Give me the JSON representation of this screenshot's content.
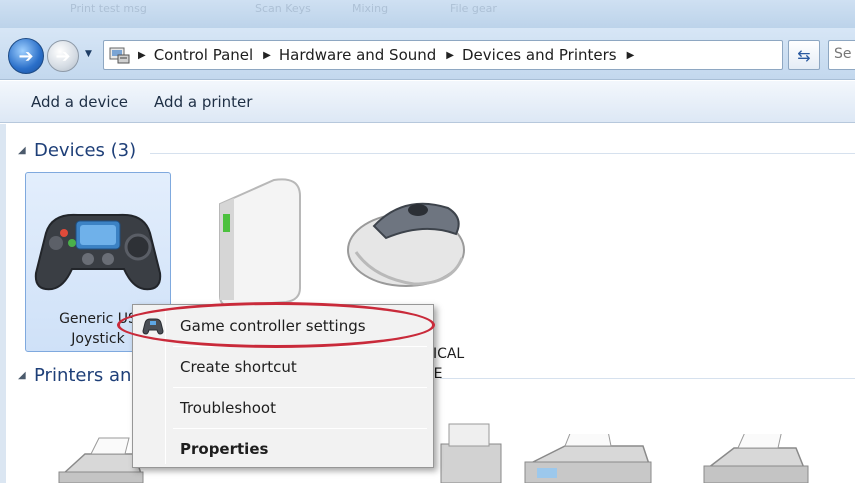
{
  "window": {
    "menu_ghosts": [
      "Print test msg",
      "Scan Keys",
      "Mixing",
      "File gear"
    ]
  },
  "nav": {
    "breadcrumbs": [
      "Control Panel",
      "Hardware and Sound",
      "Devices and Printers"
    ],
    "search_placeholder": "Se"
  },
  "command_bar": {
    "add_device": "Add a device",
    "add_printer": "Add a printer"
  },
  "groups": {
    "devices_title": "Devices (3)",
    "printers_title": "Printers an"
  },
  "devices": [
    {
      "label_line1": "Generic  US",
      "label_line2": "Joystick",
      "icon": "gamepad-icon",
      "selected": true
    },
    {
      "label_line1": "",
      "label_line2": "",
      "icon": "external-drive-icon",
      "selected": false
    },
    {
      "label_line1": "USB OPTICAL",
      "label_line2": "E",
      "icon": "mouse-icon",
      "selected": false
    }
  ],
  "context_menu": {
    "items": [
      {
        "label": "Game controller settings",
        "icon": "gamepad-icon",
        "bold": false
      },
      {
        "label": "Create shortcut",
        "bold": false
      },
      {
        "label": "Troubleshoot",
        "bold": false
      },
      {
        "label": "Properties",
        "bold": true
      }
    ]
  },
  "colors": {
    "accent": "#1e3f78",
    "highlight": "#c92a3a"
  }
}
